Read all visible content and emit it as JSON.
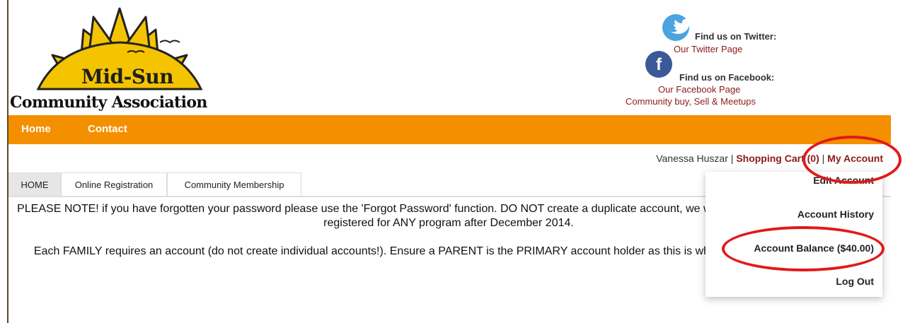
{
  "logo": {
    "line1": "Mid-Sun",
    "line2": "Community Association"
  },
  "social": {
    "twitter": {
      "title": "Find us on Twitter:",
      "link": "Our Twitter Page"
    },
    "facebook": {
      "title": "Find us on Facebook:",
      "link": "Our Facebook Page",
      "extra_link": "Community buy, Sell & Meetups",
      "icon_letter": "f"
    }
  },
  "nav": {
    "items": [
      {
        "label": "Home"
      },
      {
        "label": "Contact"
      }
    ]
  },
  "account_bar": {
    "user": "Vanessa Huszar",
    "sep": "|",
    "cart": "Shopping Cart (0)",
    "my_account": "My Account"
  },
  "tabs": [
    {
      "label": "HOME"
    },
    {
      "label": "Online Registration"
    },
    {
      "label": "Community Membership"
    }
  ],
  "content": {
    "notice": "PLEASE NOTE! if you have forgotten your password please use the 'Forgot Password' function. DO NOT create a duplicate account, we will merge your account if you have registered for ANY program after December 2014.",
    "family": "Each FAMILY requires an account (do not create individual accounts!). Ensure a PARENT is the PRIMARY account holder as this is who tax receipts will be issued to!"
  },
  "dropdown": [
    {
      "label": "Edit Account"
    },
    {
      "label": "Account History"
    },
    {
      "label": "Account Balance ($40.00)"
    },
    {
      "label": "Log Out"
    }
  ],
  "colors": {
    "nav_orange": "#f48f00",
    "link_red": "#8b1a1a",
    "annotation": "#e11919"
  }
}
